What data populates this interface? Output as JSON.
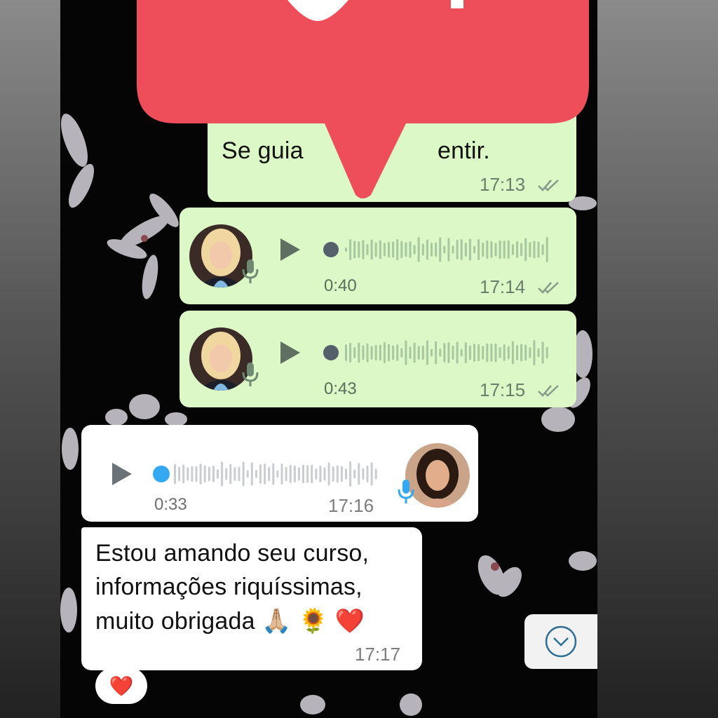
{
  "colors": {
    "outgoing_bubble": "#dcf8c6",
    "incoming_bubble": "#ffffff",
    "overlay_red": "#ee4d5a",
    "played_dot": "#55606a",
    "unplayed_dot": "#34a8f0",
    "mic_outgoing": "#6f8a72",
    "mic_incoming": "#34a8f0"
  },
  "messages": [
    {
      "type": "text",
      "direction": "outgoing",
      "partial_text": "Se guia",
      "partial_text_2": "entir.",
      "time": "17:13",
      "status": "read-double-check"
    },
    {
      "type": "voice",
      "direction": "outgoing",
      "duration": "0:40",
      "time": "17:14",
      "status": "read-double-check",
      "progress": 0
    },
    {
      "type": "voice",
      "direction": "outgoing",
      "duration": "0:43",
      "time": "17:15",
      "status": "read-double-check",
      "progress": 0
    },
    {
      "type": "voice",
      "direction": "incoming",
      "duration": "0:33",
      "time": "17:16",
      "progress": 0
    },
    {
      "type": "text",
      "direction": "incoming",
      "lines": [
        "Estou amando seu curso,",
        "informações riquíssimas,",
        "muito obrigada 🙏🏼 🌻 ❤️"
      ],
      "time": "17:17",
      "reaction": "❤️"
    }
  ],
  "icons": {
    "overlay": "heart-notification-icon",
    "scroll": "chevron-down-icon",
    "play": "play-icon",
    "mic": "microphone-icon",
    "ticks": "double-check-icon"
  }
}
